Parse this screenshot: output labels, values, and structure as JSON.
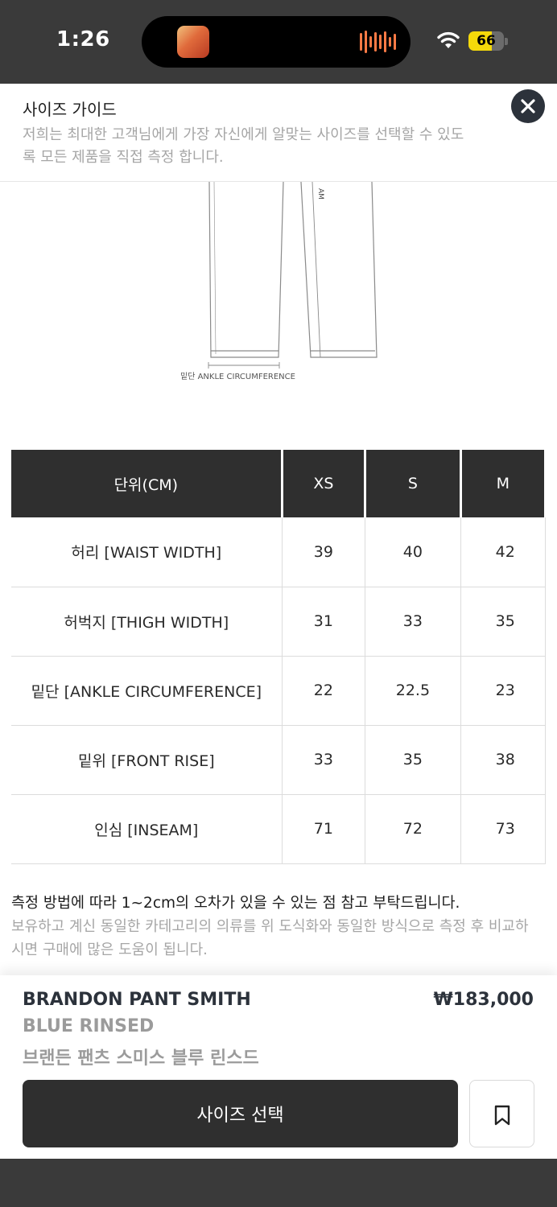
{
  "status_bar": {
    "time": "1:26",
    "battery": "66",
    "battery_level": 0.66
  },
  "sheet": {
    "title": "사이즈 가이드",
    "description": "저희는 최대한 고객님에게 가장 자신에게 알맞는 사이즈를 선택할 수 있도록 모든 제품을 직접 측정 합니다.",
    "diagram_inseam_label": "AM",
    "diagram_caption": "밑단 ANKLE CIRCUMFERENCE"
  },
  "size_table": {
    "header": [
      "단위(CM)",
      "XS",
      "S",
      "M"
    ],
    "rows": [
      [
        "허리 [WAIST WIDTH]",
        "39",
        "40",
        "42"
      ],
      [
        "허벅지 [THIGH WIDTH]",
        "31",
        "33",
        "35"
      ],
      [
        "밑단 [ANKLE CIRCUMFERENCE]",
        "22",
        "22.5",
        "23"
      ],
      [
        "밑위 [FRONT RISE]",
        "33",
        "35",
        "38"
      ],
      [
        "인심 [INSEAM]",
        "71",
        "72",
        "73"
      ]
    ]
  },
  "notes": {
    "main": "측정 방법에 따라 1~2cm의 오차가 있을 수 있는 점 참고 부탁드립니다.",
    "sub": "보유하고 계신 동일한 카테고리의 의류를 위 도식화와 동일한 방식으로 측정 후 비교하시면 구매에 많은 도움이 됩니다."
  },
  "product": {
    "name": "BRANDON PANT SMITH",
    "color": "BLUE RINSED",
    "name_kr": "브랜든 팬츠 스미스 블루 린스드",
    "price": "₩183,000",
    "select_size_label": "사이즈 선택"
  },
  "colors": {
    "header_dark": "#2f2f2f",
    "accent_battery": "#f5d90a",
    "close_button": "#2c323b"
  },
  "icons": {
    "close": "close-icon",
    "bookmark": "bookmark-icon",
    "wifi": "wifi-icon"
  }
}
